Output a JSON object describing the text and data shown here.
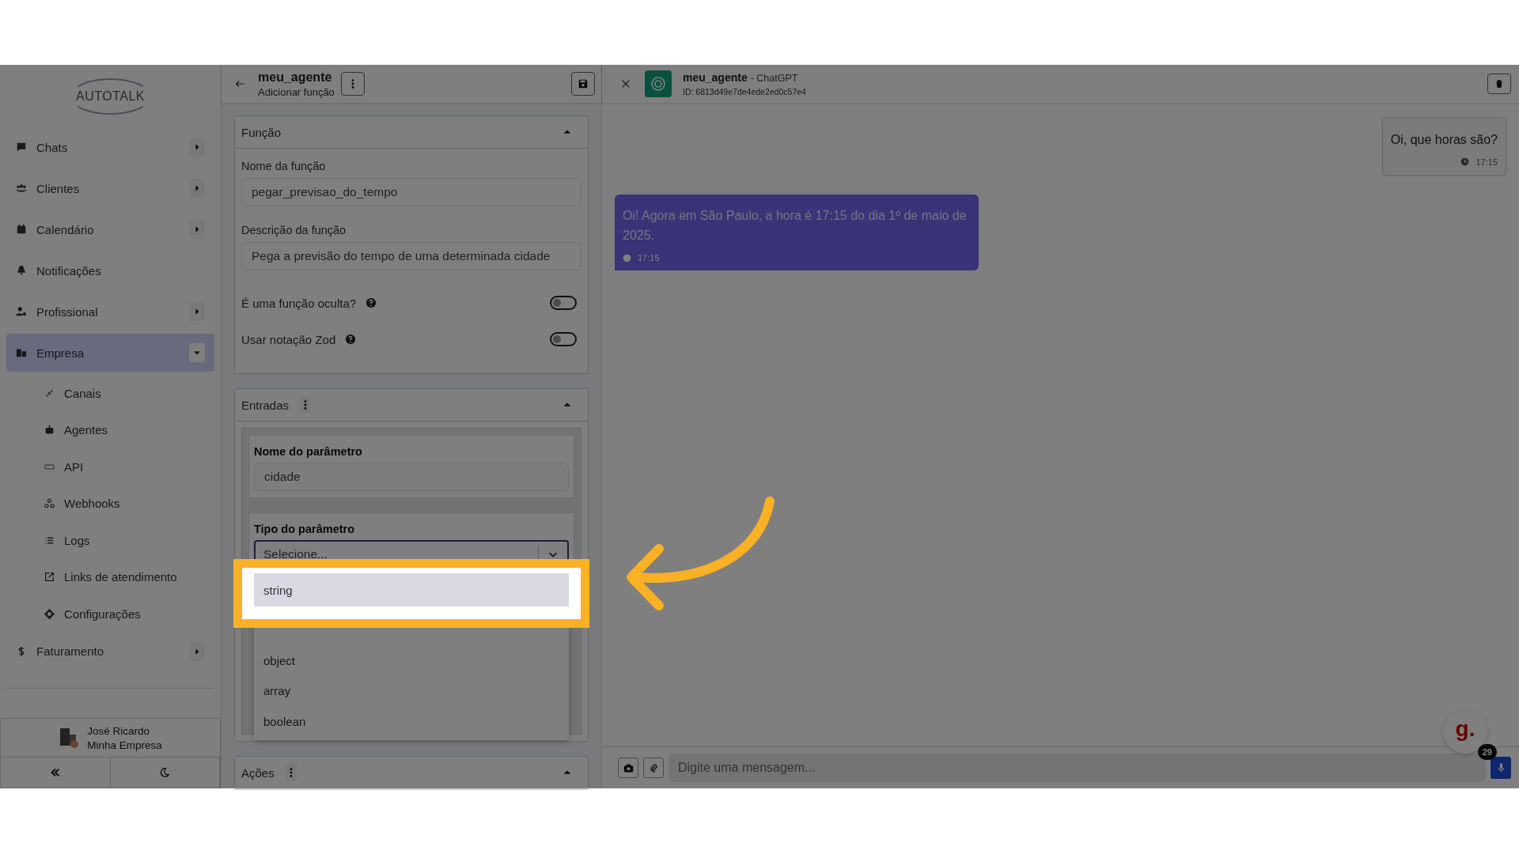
{
  "sidebar": {
    "logo": "AUTOTALK",
    "items": [
      {
        "label": "Chats",
        "kind": "group",
        "expanded": false,
        "selected": false
      },
      {
        "label": "Clientes",
        "kind": "group",
        "expanded": false,
        "selected": false
      },
      {
        "label": "Calendário",
        "kind": "group",
        "expanded": false,
        "selected": false
      },
      {
        "label": "Notificações",
        "kind": "link",
        "selected": false
      },
      {
        "label": "Profissional",
        "kind": "group",
        "expanded": false,
        "selected": false
      },
      {
        "label": "Empresa",
        "kind": "group",
        "expanded": true,
        "selected": true,
        "children": [
          {
            "label": "Canais",
            "selected": false
          },
          {
            "label": "Agentes",
            "selected": false
          },
          {
            "label": "API",
            "selected": false
          },
          {
            "label": "Webhooks",
            "selected": false
          },
          {
            "label": "Logs",
            "selected": false
          },
          {
            "label": "Links de atendimento",
            "selected": false
          },
          {
            "label": "Configurações",
            "selected": false
          }
        ]
      },
      {
        "label": "Faturamento",
        "kind": "group",
        "expanded": false,
        "selected": false
      }
    ],
    "user": {
      "name": "José Ricardo",
      "company": "Minha Empresa"
    }
  },
  "editor": {
    "title": "meu_agente",
    "subtitle": "Adicionar função",
    "function_section": {
      "title": "Função",
      "expanded": true,
      "fields": [
        {
          "label": "Nome da função",
          "value": "pegar_previsao_do_tempo"
        },
        {
          "label": "Descrição da função",
          "value": "Pega a previsão do tempo de uma determinada cidade"
        }
      ],
      "toggles": [
        {
          "label": "É uma função oculta?",
          "on": false
        },
        {
          "label": "Usar notação Zod",
          "on": false
        }
      ]
    },
    "inputs_section": {
      "title": "Entradas",
      "expanded": true,
      "param_name": {
        "label": "Nome do parâmetro",
        "value": "cidade"
      },
      "param_type": {
        "label": "Tipo do parâmetro",
        "placeholder": "Selecione...",
        "options": [
          {
            "label": "string",
            "highlighted": true
          },
          {
            "label": "object",
            "highlighted": false
          },
          {
            "label": "array",
            "highlighted": false
          },
          {
            "label": "boolean",
            "highlighted": false
          }
        ]
      }
    },
    "actions_section": {
      "title": "Ações",
      "expanded": true
    }
  },
  "chat": {
    "agent_name": "meu_agente",
    "model": "- ChatGPT",
    "agent_id": "ID: 6813d49e7de4ede2ed0c57e4",
    "messages": [
      {
        "kind": "user",
        "text": "Oi, que horas são?",
        "time": "17:15"
      },
      {
        "kind": "agent",
        "text": "Oi! Agora em São Paulo, a hora é 17:15 do dia 1º de maio de 2025.",
        "time": "17:15"
      }
    ],
    "input": {
      "placeholder": "Digite uma mensagem..."
    },
    "widget": {
      "logo": "g.",
      "badge": "29"
    }
  }
}
